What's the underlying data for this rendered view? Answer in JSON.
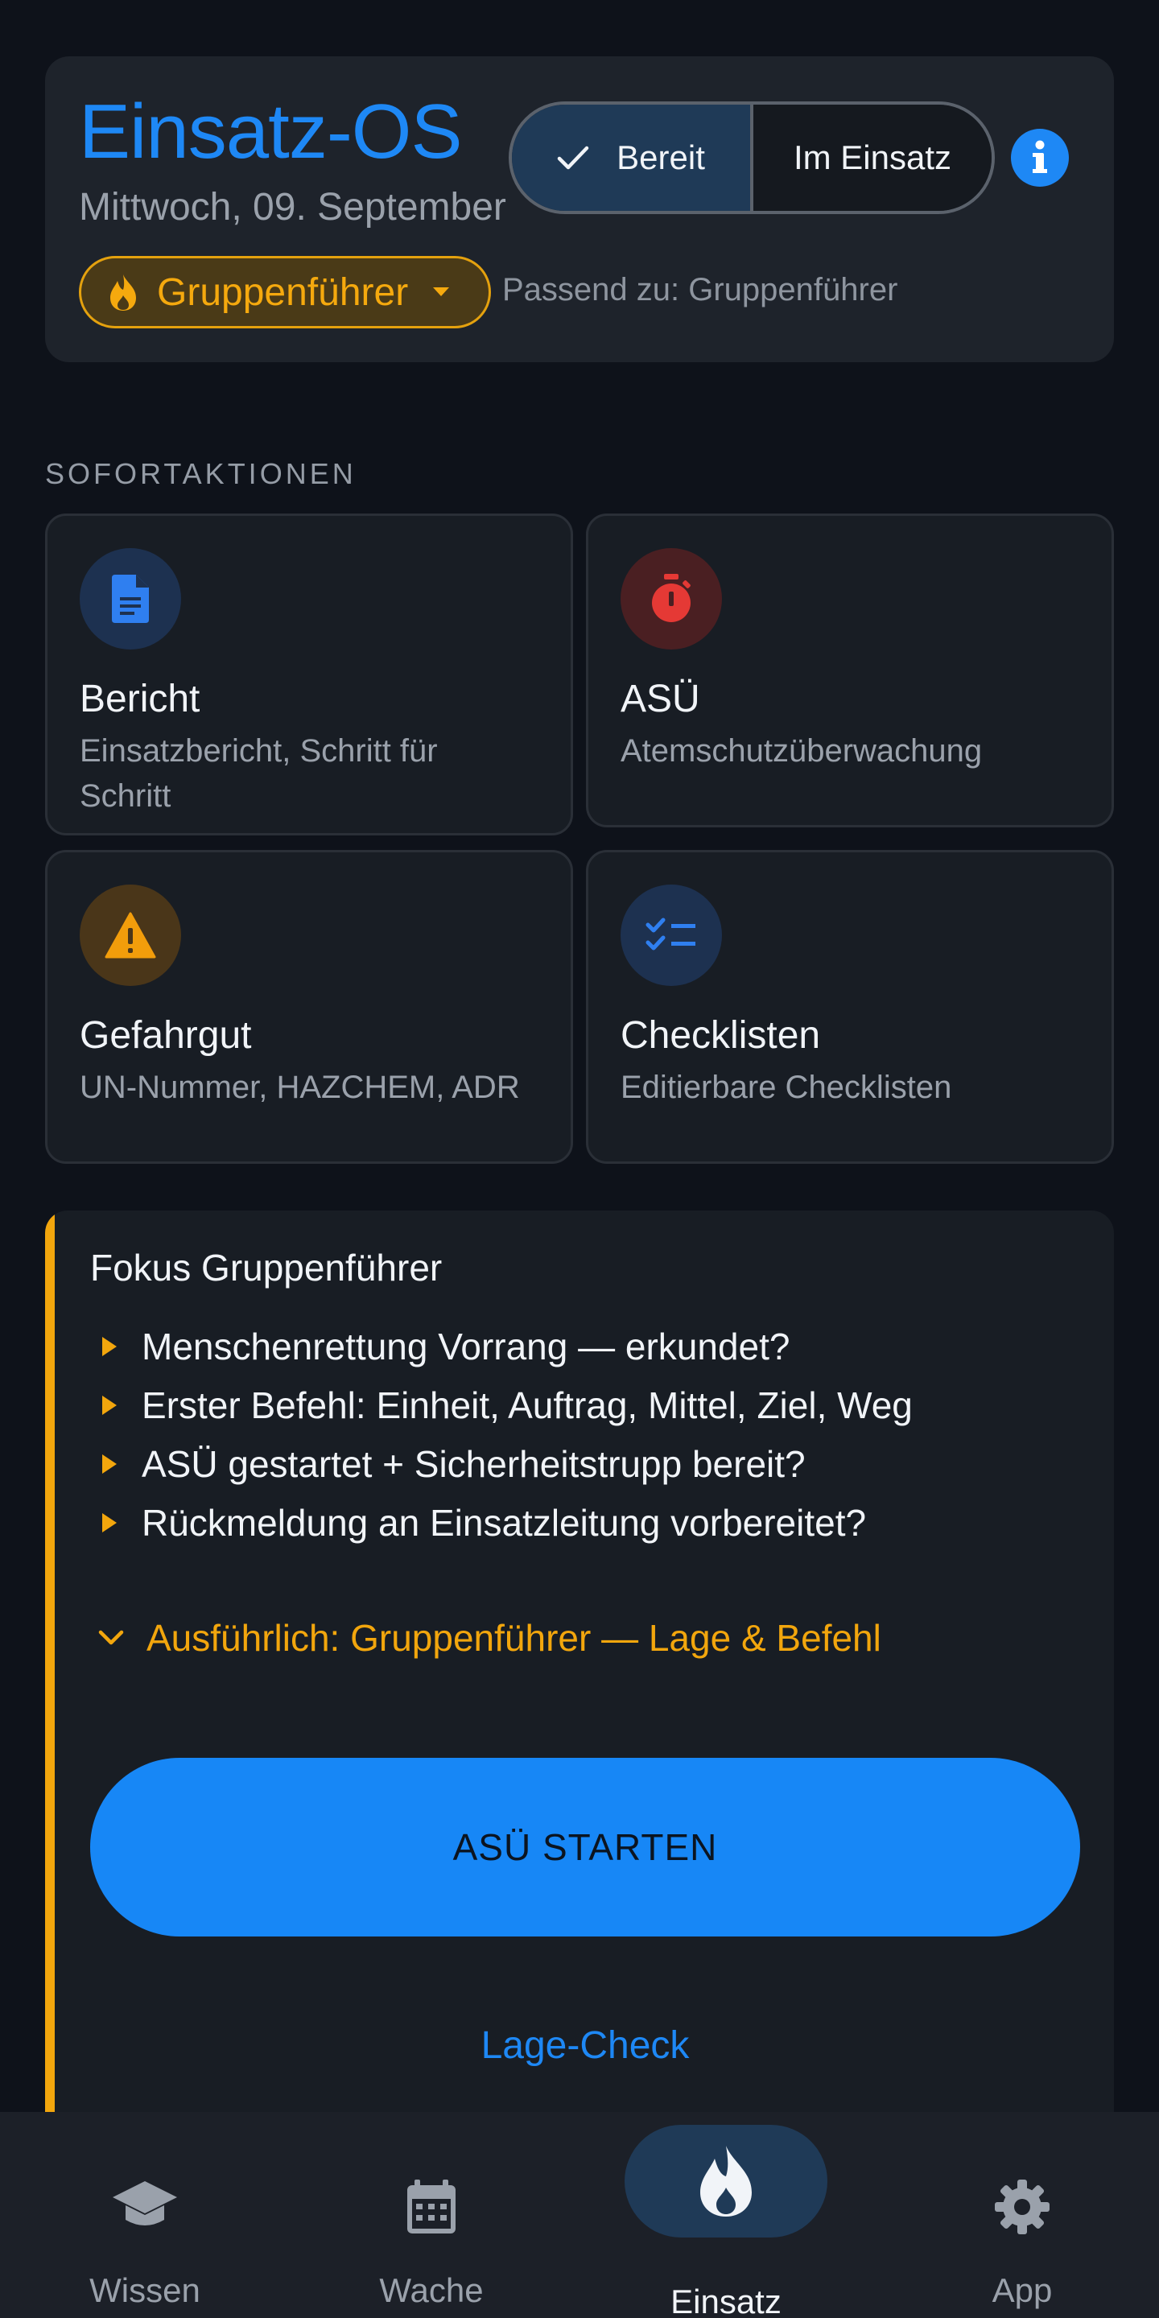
{
  "header": {
    "title": "Einsatz-OS",
    "date": "Mittwoch, 09. September",
    "status_toggle": {
      "ready_label": "Bereit",
      "active_label": "Im Einsatz",
      "selected": "Bereit"
    },
    "role_chip": {
      "label": "Gruppenführer",
      "icon": "flame-icon"
    },
    "role_hint": "Passend zu: Gruppenführer"
  },
  "quick_actions": {
    "heading": "SOFORTAKTIONEN",
    "items": [
      {
        "title": "Bericht",
        "subtitle": "Einsatzbericht, Schritt für Schritt",
        "icon": "document-icon",
        "color": "#2f7ff0"
      },
      {
        "title": "ASÜ",
        "subtitle": "Atemschutzüberwachung",
        "icon": "stopwatch-icon",
        "color": "#e53935"
      },
      {
        "title": "Gefahrgut",
        "subtitle": "UN-Nummer, HAZCHEM, ADR",
        "icon": "warning-icon",
        "color": "#f29d0b"
      },
      {
        "title": "Checklisten",
        "subtitle": "Editierbare Checklisten",
        "icon": "checklist-icon",
        "color": "#2f7ff0"
      }
    ]
  },
  "focus": {
    "title": "Fokus Gruppenführer",
    "items": [
      "Menschenrettung Vorrang — erkundet?",
      "Erster Befehl: Einheit, Auftrag, Mittel, Ziel, Weg",
      "ASÜ gestartet + Sicherheitstrupp bereit?",
      "Rückmeldung an Einsatzleitung vorbereitet?"
    ],
    "expand_label": "Ausführlich: Gruppenführer — Lage & Befehl",
    "primary_button": "ASÜ STARTEN",
    "secondary_link": "Lage-Check",
    "accent_color": "#f2a60d"
  },
  "nav": {
    "items": [
      {
        "label": "Wissen",
        "icon": "graduation-cap-icon"
      },
      {
        "label": "Wache",
        "icon": "calendar-icon"
      },
      {
        "label": "Einsatz",
        "icon": "flame-icon",
        "active": true
      },
      {
        "label": "App",
        "icon": "gear-icon"
      }
    ]
  }
}
